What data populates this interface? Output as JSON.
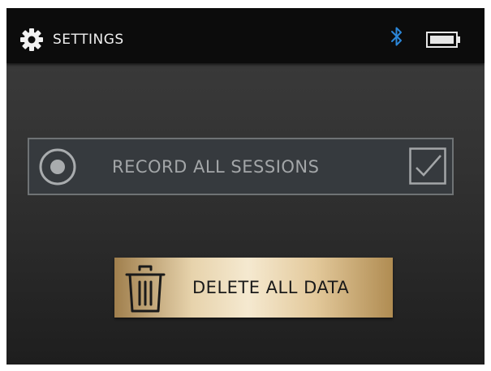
{
  "header": {
    "title": "SETTINGS",
    "icons": [
      "gear-icon",
      "bluetooth-icon",
      "battery-icon"
    ],
    "bluetooth_color": "#2b86d8"
  },
  "record_option": {
    "label": "RECORD ALL SESSIONS",
    "checked": true
  },
  "delete_button": {
    "label": "DELETE ALL DATA",
    "icon": "trash-icon"
  },
  "colors": {
    "accent_gold": "#e7d3ac",
    "panel_border": "#6f7375",
    "label_gray": "#a3a6a8"
  }
}
